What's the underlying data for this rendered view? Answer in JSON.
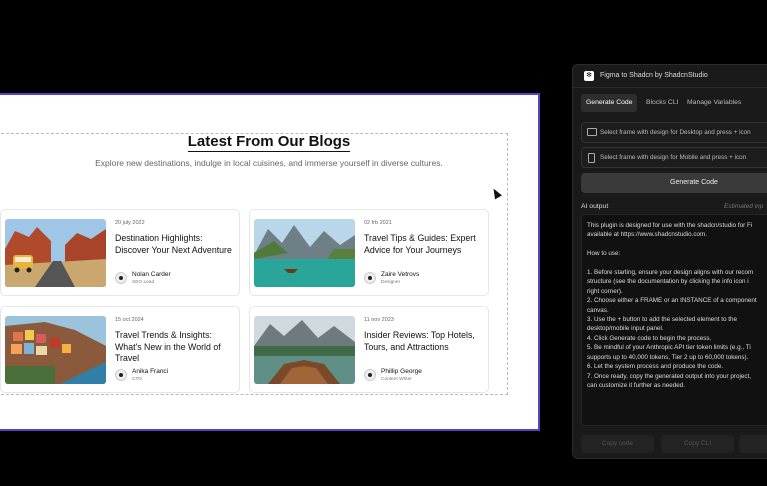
{
  "blog": {
    "title": "Latest From Our Blogs",
    "subtitle": "Explore new destinations, indulge in local cuisines, and immerse yourself in diverse cultures.",
    "posts": [
      {
        "date": "20 july 2022",
        "title": "Destination Highlights: Discover Your Next Adventure",
        "author": "Nolan Carder",
        "role": "SEO Lead",
        "image": "desert-road-van"
      },
      {
        "date": "02 frb 2021",
        "title": "Travel Tips & Guides: Expert Advice for Your Journeys",
        "author": "Zaire Vetrovs",
        "role": "Designer",
        "image": "mountain-lake-boat"
      },
      {
        "date": "15 oct 2024",
        "title": "Travel Trends & Insights: What's New in the World of Travel",
        "author": "Anika Franci",
        "role": "CTO",
        "image": "coastal-village"
      },
      {
        "date": "11 nov 2023",
        "title": "Insider Reviews: Top Hotels, Tours, and Attractions",
        "author": "Phillip George",
        "role": "Content Writer",
        "image": "boat-on-lake"
      }
    ]
  },
  "plugin": {
    "title": "Figma to Shadcn by ShadcnStudio",
    "tabs": [
      "Generate Code",
      "Blocks CLI",
      "Manage Variables"
    ],
    "active_tab": "Generate Code",
    "desktop_select": "Select frame with design for Desktop and press + icon",
    "mobile_select": "Select frame with design for Mobile and press + icon",
    "generate_button": "Generate Code",
    "ai_output_label": "AI output",
    "estimated_label": "Estimated inp",
    "ai_output_text": "This plugin is designed for use with the shadcn/studio for Fi\navailable at https://www.shadcnstudio.com.\n\nHow to use:\n\n1. Before starting, ensure your design aligns with our recom\nstructure (see the documentation by clicking the info icon i\nright corner).\n2. Choose either a FRAME or an INSTANCE of a component\ncanvas.\n3. Use the + button to add the selected element to the\ndesktop/mobile input panel.\n4. Click Generate code to begin the process.\n5. Be mindful of your Anthropic API tier token limits (e.g., Ti\nsupports up to 40,000 tokens, Tier 2 up to 60,000 tokens).\n6. Let the system process and produce the code.\n7. Once ready, copy the generated output into your project,\ncan customize it further as needed.",
    "footer_buttons": [
      "Copy code",
      "Copy CLI",
      "Op"
    ]
  },
  "colors": {
    "frame_border": "#5a3fc8",
    "panel_bg": "#1a1a1a",
    "page_bg": "#000000"
  }
}
